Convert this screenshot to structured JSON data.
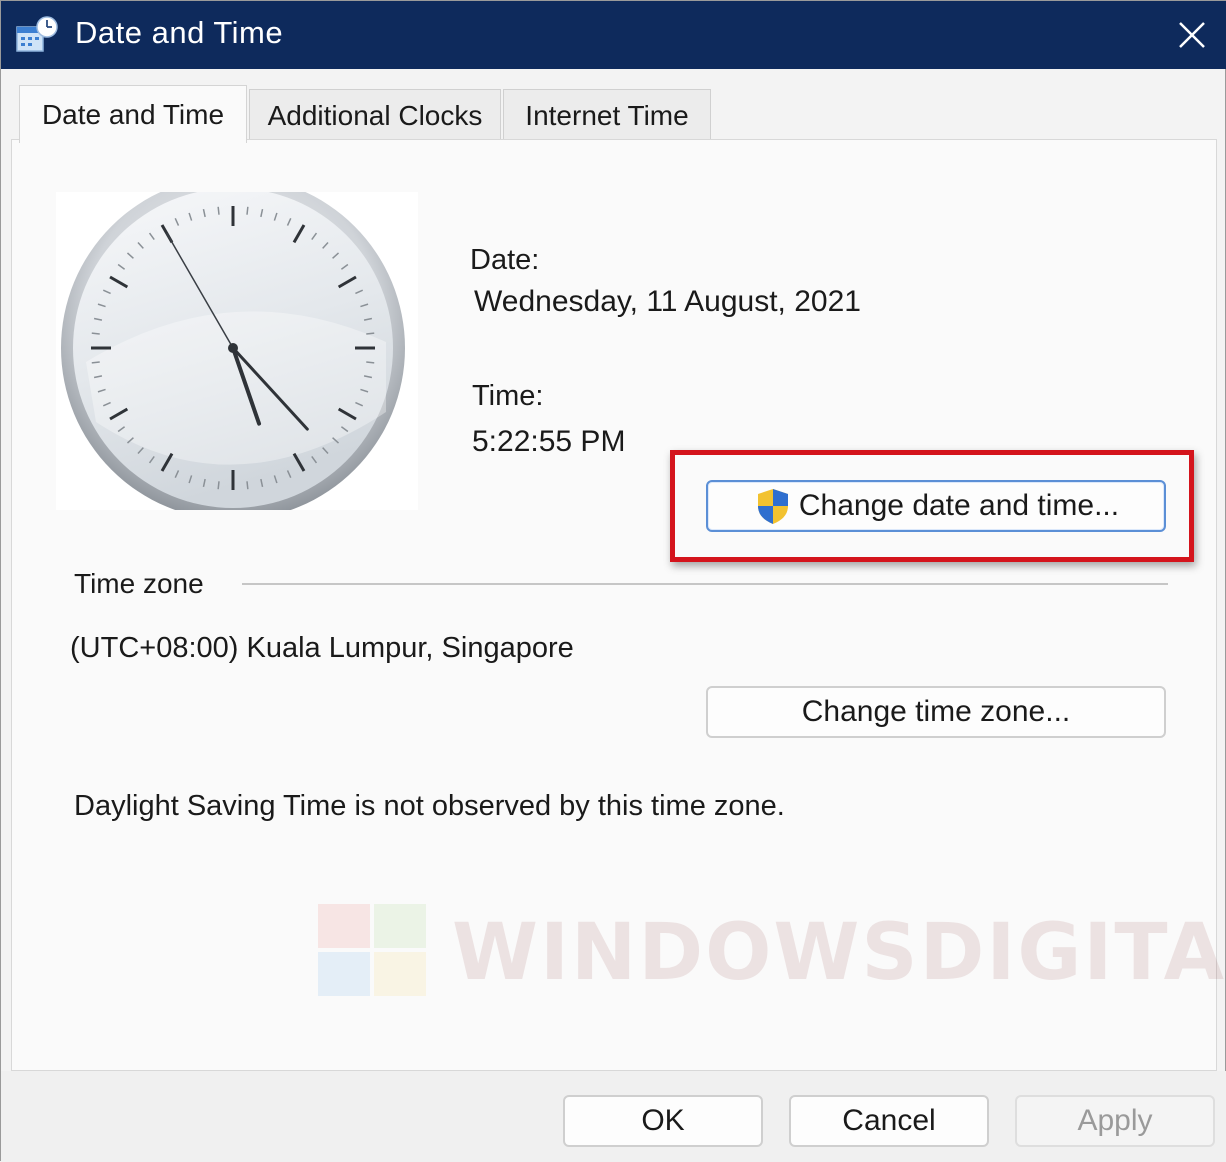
{
  "window": {
    "title": "Date and Time",
    "close_glyph": "✕",
    "icon": "date-time-control-panel-icon"
  },
  "tabs": [
    {
      "label": "Date and Time",
      "active": true
    },
    {
      "label": "Additional Clocks",
      "active": false
    },
    {
      "label": "Internet Time",
      "active": false
    }
  ],
  "date": {
    "label": "Date:",
    "value": "Wednesday, 11 August, 2021"
  },
  "time": {
    "label": "Time:",
    "value": "5:22:55 PM"
  },
  "clock": {
    "hours": 5,
    "minutes": 22,
    "seconds": 55
  },
  "buttons": {
    "change_date_time": "Change date and time...",
    "change_time_zone": "Change time zone...",
    "ok": "OK",
    "cancel": "Cancel",
    "apply": "Apply"
  },
  "time_zone": {
    "heading": "Time zone",
    "value": "(UTC+08:00) Kuala Lumpur, Singapore",
    "dst_note": "Daylight Saving Time is not observed by this time zone."
  },
  "watermark": {
    "text": "WINDOWSDIGITAL.CO"
  },
  "colors": {
    "titlebar": "#0e2a5c",
    "highlight": "#d4141c",
    "focus_border": "#5b8fd6"
  }
}
